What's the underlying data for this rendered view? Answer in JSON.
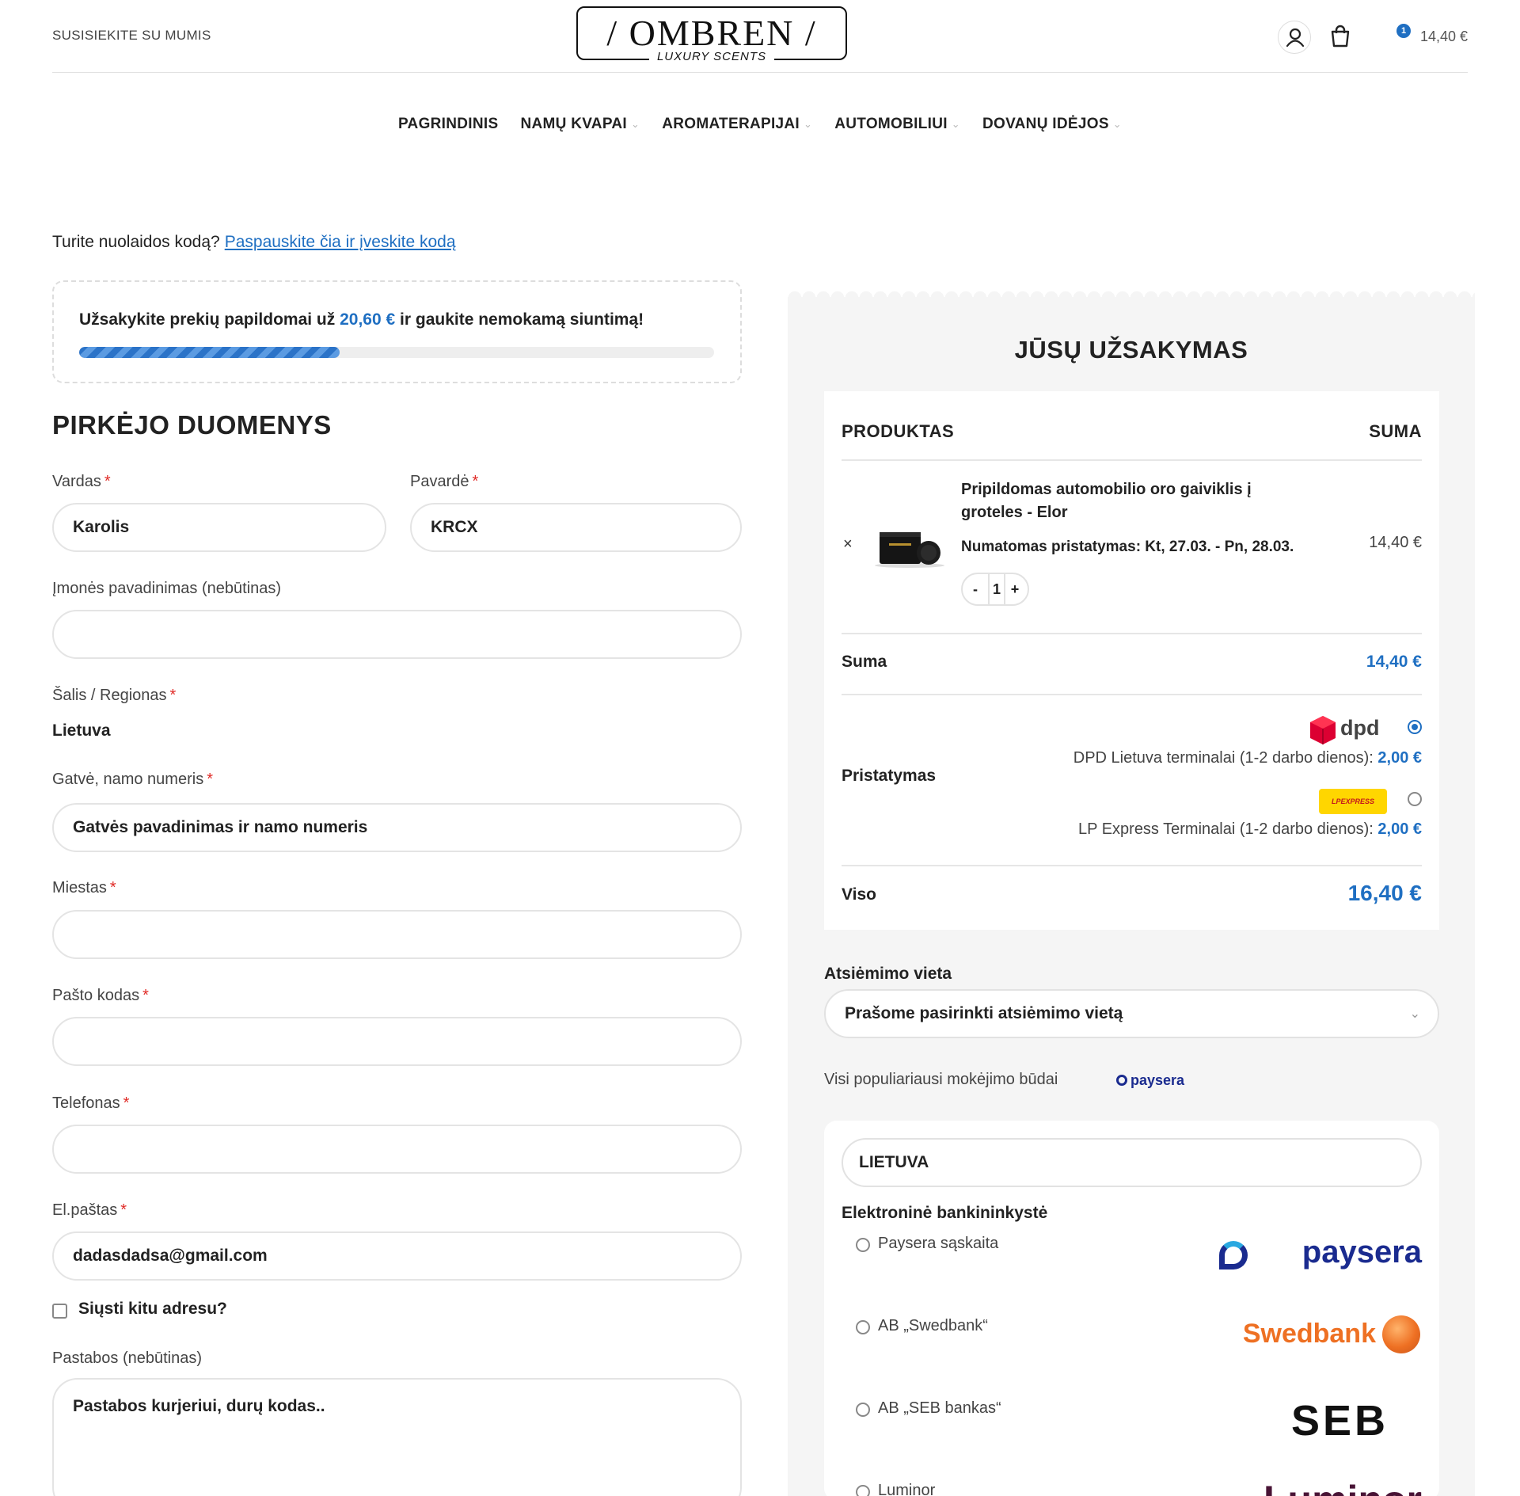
{
  "header": {
    "contact": "SUSISIEKITE SU MUMIS",
    "logo_main": "/ OMBREN /",
    "logo_sub": "LUXURY SCENTS",
    "cart_count": "1",
    "cart_total": "14,40 €"
  },
  "nav": [
    {
      "label": "PAGRINDINIS",
      "has_dropdown": false
    },
    {
      "label": "NAMŲ KVAPAI",
      "has_dropdown": true
    },
    {
      "label": "AROMATERAPIJAI",
      "has_dropdown": true
    },
    {
      "label": "AUTOMOBILIUI",
      "has_dropdown": true
    },
    {
      "label": "DOVANŲ IDĖJOS",
      "has_dropdown": true
    }
  ],
  "coupon": {
    "text": "Turite nuolaidos kodą?",
    "link": "Paspauskite čia ir įveskite kodą"
  },
  "free_shipping": {
    "before": "Užsakykite prekių papildomai už",
    "amount": "20,60 €",
    "after": "ir gaukite nemokamą siuntimą!",
    "progress_pct": 41
  },
  "billing": {
    "title": "PIRKĖJO DUOMENYS",
    "first_name_label": "Vardas",
    "first_name_value": "Karolis",
    "last_name_label": "Pavardė",
    "last_name_value": "KRCX",
    "company_label": "Įmonės pavadinimas (nebūtinas)",
    "company_value": "",
    "country_label": "Šalis / Regionas",
    "country_value": "Lietuva",
    "street_label": "Gatvė, namo numeris",
    "street_placeholder": "Gatvės pavadinimas ir namo numeris",
    "city_label": "Miestas",
    "postcode_label": "Pašto kodas",
    "phone_label": "Telefonas",
    "email_label": "El.paštas",
    "email_value": "dadasdadsa@gmail.com",
    "ship_diff_label": "Siųsti kitu adresu?",
    "notes_label": "Pastabos (nebūtinas)",
    "notes_placeholder": "Pastabos kurjeriui, durų kodas..",
    "required_mark": "*"
  },
  "order": {
    "title": "JŪSŲ UŽSAKYMAS",
    "col_product": "PRODUKTAS",
    "col_sum": "SUMA",
    "remove_icon": "×",
    "product_name": "Pripildomas automobilio oro gaiviklis į groteles - Elor",
    "delivery_estimate": "Numatomas pristatymas: Kt, 27.03. - Pn, 28.03.",
    "product_price": "14,40 €",
    "qty_minus": "-",
    "qty": "1",
    "qty_plus": "+",
    "subtotal_label": "Suma",
    "subtotal_value": "14,40 €",
    "shipping_label": "Pristatymas",
    "dpd_logo_text": "dpd",
    "dpd_label": "DPD Lietuva terminalai (1-2 darbo dienos):",
    "dpd_price": "2,00 €",
    "lp_logo_text": "LPEXPRESS",
    "lp_label": "LP Express Terminalai (1-2 darbo dienos):",
    "lp_price": "2,00 €",
    "total_label": "Viso",
    "total_value": "16,40 €"
  },
  "pickup": {
    "label": "Atsiėmimo vieta",
    "placeholder": "Prašome pasirinkti atsiėmimo vietą"
  },
  "payment": {
    "intro": "Visi populiariausi mokėjimo būdai",
    "paysera_small": "paysera",
    "country": "LIETUVA",
    "group_title": "Elektroninė bankininkystė",
    "banks": [
      {
        "name": "Paysera sąskaita",
        "logo": "paysera"
      },
      {
        "name": "AB „Swedbank“",
        "logo": "Swedbank"
      },
      {
        "name": "AB „SEB bankas“",
        "logo": "SEB"
      },
      {
        "name": "Luminor",
        "logo": "Luminor"
      }
    ]
  },
  "colors": {
    "accent": "#1f6fc2",
    "required": "#e02b27",
    "dpd_red": "#dc0032",
    "lp_yellow": "#ffd600",
    "swedbank_orange": "#ee7023",
    "paysera_navy": "#1a2b8f",
    "luminor_maroon": "#481335"
  }
}
